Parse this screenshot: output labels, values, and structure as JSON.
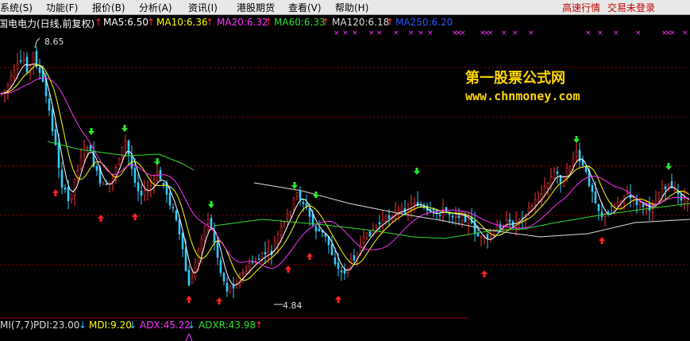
{
  "menubar": {
    "items": [
      "系统(S)",
      "功能(F)",
      "报价(B)",
      "分析(A)",
      "资讯(I)",
      "港股期货",
      "查看(V)",
      "帮助(H)"
    ],
    "right": [
      "高速行情",
      "交易未登录"
    ]
  },
  "chart_header": {
    "stock_title": "国电电力(日线,前复权)",
    "ma_labels": [
      "MA5:6.50",
      "MA10:6.36",
      "MA20:6.32",
      "MA60:6.33",
      "MA120:6.18",
      "MA250:6.20"
    ],
    "ma_colors": [
      "#ffffff",
      "#ffff00",
      "#ff33ff",
      "#33dd33",
      "#dddddd",
      "#3355ff"
    ]
  },
  "annotations": {
    "high_price": "8.65",
    "low_price": "4.84"
  },
  "watermark": {
    "title": "第一股票公式网",
    "url": "www.chnmoney.com"
  },
  "indicator": {
    "name": "MI(7,7)",
    "values": [
      "PDI:23.00",
      "MDI:9.20",
      "ADX:45.22",
      "ADXR:43.98"
    ],
    "colors": [
      "#dddddd",
      "#ffff00",
      "#ff33ff",
      "#33dd33"
    ],
    "arrows": [
      "down",
      "down",
      "down",
      "up"
    ]
  },
  "colors": {
    "up_candle": "#ff3333",
    "down_candle": "#33ccff",
    "grid": "#8b0000",
    "buy_arrow": "#ff2222",
    "sell_arrow": "#22ee22"
  }
}
